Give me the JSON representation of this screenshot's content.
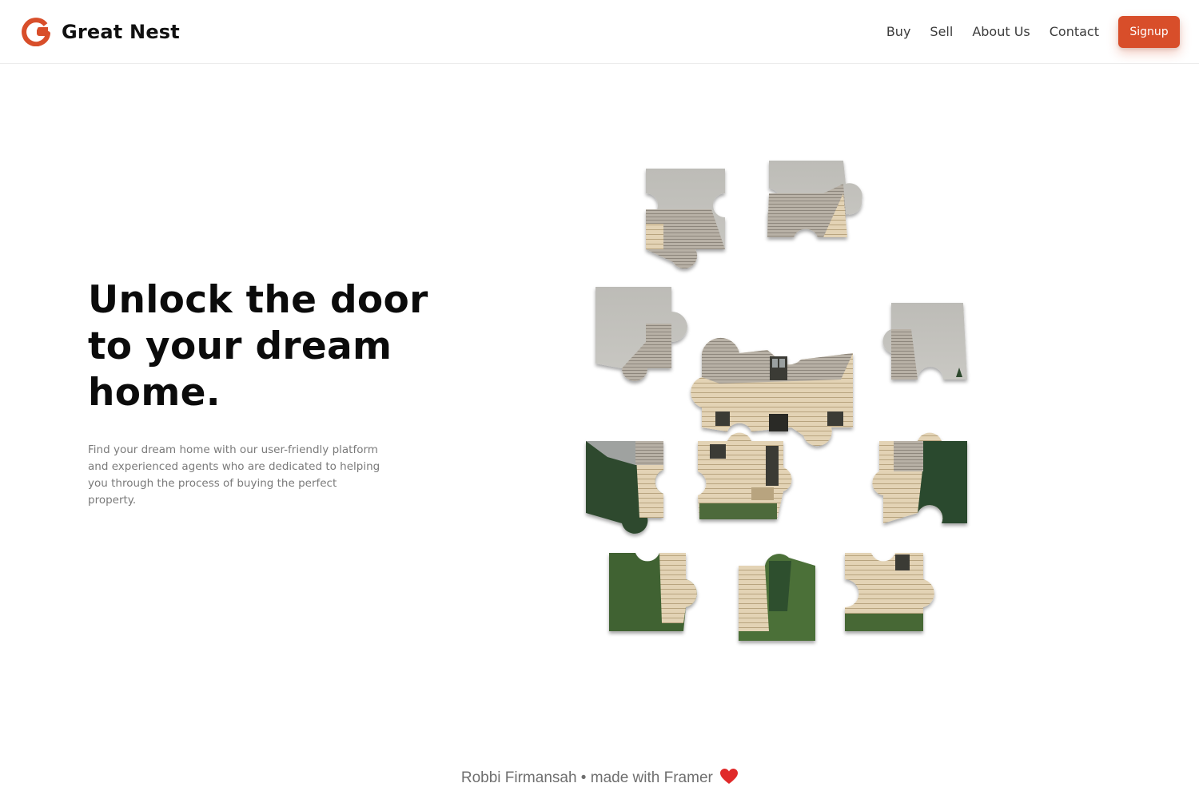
{
  "brand": {
    "name": "Great Nest",
    "logo_icon": "g-logo-icon",
    "accent_color": "#d84e2a"
  },
  "nav": {
    "items": [
      {
        "label": "Buy"
      },
      {
        "label": "Sell"
      },
      {
        "label": "About Us"
      },
      {
        "label": "Contact"
      }
    ],
    "signup_label": "Signup"
  },
  "hero": {
    "title": "Unlock the door to your dream home.",
    "subtitle": "Find your dream home with our user-friendly platform and experienced agents who are dedicated to helping you through the process of buying the perfect property.",
    "image": "house-jigsaw-puzzle-pieces"
  },
  "footer": {
    "text": "Robbi Firmansah • made with Framer",
    "icon": "heart-icon"
  }
}
